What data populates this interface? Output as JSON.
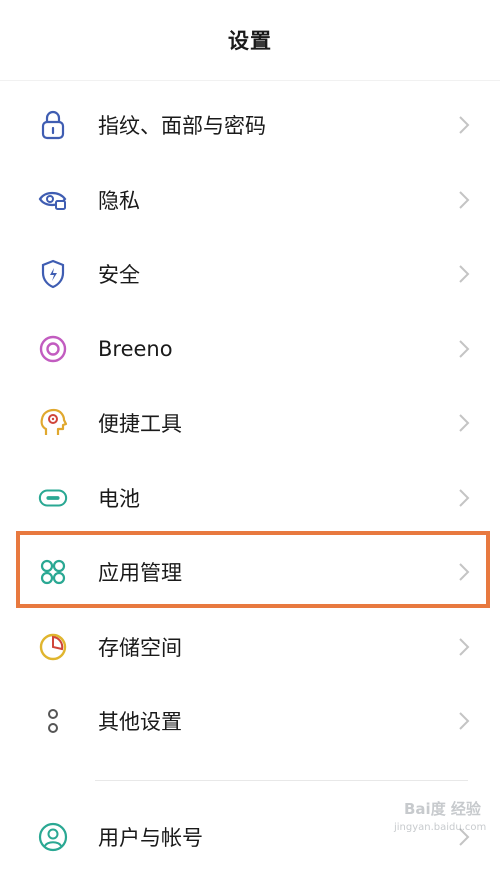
{
  "header": {
    "title": "设置"
  },
  "settings": {
    "items": [
      {
        "label": "指纹、面部与密码",
        "icon": "lock-icon"
      },
      {
        "label": "隐私",
        "icon": "privacy-eye-icon"
      },
      {
        "label": "安全",
        "icon": "shield-icon"
      },
      {
        "label": "Breeno",
        "icon": "breeno-ring-icon"
      },
      {
        "label": "便捷工具",
        "icon": "head-bulb-icon"
      },
      {
        "label": "电池",
        "icon": "battery-icon"
      },
      {
        "label": "应用管理",
        "icon": "apps-grid-icon"
      },
      {
        "label": "存储空间",
        "icon": "storage-pie-icon"
      },
      {
        "label": "其他设置",
        "icon": "more-dots-icon"
      }
    ],
    "last_item": {
      "label": "用户与帐号",
      "icon": "user-icon"
    }
  },
  "highlight_color": "#e8793f",
  "watermark": {
    "brand": "Bai度 经验",
    "sub": "jingyan.baidu.com"
  }
}
